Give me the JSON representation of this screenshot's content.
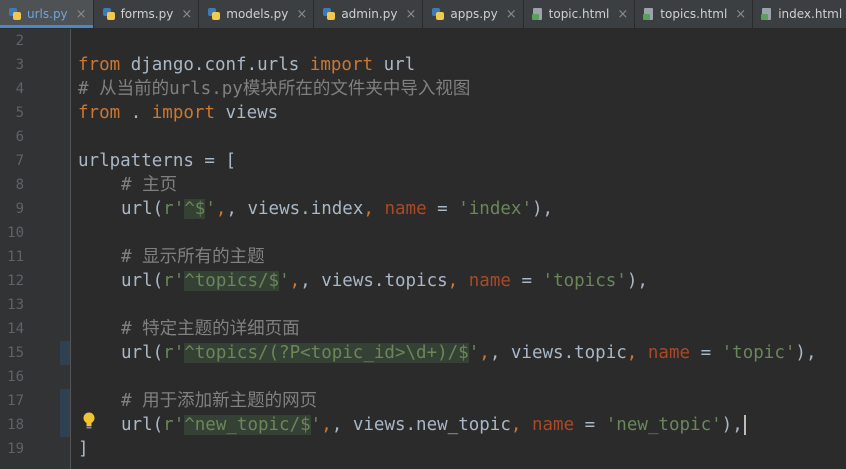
{
  "tabs": [
    {
      "label": "urls.py",
      "type": "py",
      "active": true
    },
    {
      "label": "forms.py",
      "type": "py",
      "active": false
    },
    {
      "label": "models.py",
      "type": "py",
      "active": false
    },
    {
      "label": "admin.py",
      "type": "py",
      "active": false
    },
    {
      "label": "apps.py",
      "type": "py",
      "active": false
    },
    {
      "label": "topic.html",
      "type": "html",
      "active": false
    },
    {
      "label": "topics.html",
      "type": "html",
      "active": false
    },
    {
      "label": "index.html",
      "type": "html",
      "active": false
    }
  ],
  "close_glyph": "×",
  "line_numbers": [
    "2",
    "3",
    "4",
    "5",
    "6",
    "7",
    "8",
    "9",
    "10",
    "11",
    "12",
    "13",
    "14",
    "15",
    "16",
    "17",
    "18",
    "19"
  ],
  "code": {
    "l3": {
      "kw1": "from",
      "mod": " django.conf.urls ",
      "kw2": "import",
      "name": " url"
    },
    "l4": {
      "comment": "# 从当前的urls.py模块所在的文件夹中导入视图"
    },
    "l5": {
      "kw1": "from",
      "mod": " . ",
      "kw2": "import",
      "name": " views"
    },
    "l7": {
      "text": "urlpatterns = ["
    },
    "l8": {
      "comment": "# 主页"
    },
    "l9": {
      "a": "url(",
      "s1": "r'",
      "rx": "^$",
      "s2": "'",
      "b": ", views.index",
      "c": ", ",
      "kw": "name",
      "d": " = ",
      "s3": "'index'",
      "e": "),"
    },
    "l11": {
      "comment": "# 显示所有的主题"
    },
    "l12": {
      "a": "url(",
      "s1": "r'",
      "rx": "^topics/$",
      "s2": "'",
      "b": ", views.topics",
      "c": ", ",
      "kw": "name",
      "d": " = ",
      "s3": "'topics'",
      "e": "),"
    },
    "l14": {
      "comment": "# 特定主题的详细页面"
    },
    "l15": {
      "a": "url(",
      "s1": "r'",
      "rx": "^topics/(?P<topic_id>\\d+)/$",
      "s2": "'",
      "b": ", views.topic",
      "c": ", ",
      "kw": "name",
      "d": " = ",
      "s3": "'topic'",
      "e": "),"
    },
    "l17": {
      "comment": "# 用于添加新主题的网页"
    },
    "l18": {
      "a": "url(",
      "s1": "r'",
      "rx": "^new_topic/$",
      "s2": "'",
      "b": ", views.new_topic",
      "c": ", ",
      "kw": "name",
      "d": " = ",
      "s3": "'new_topic'",
      "e": "),"
    },
    "l19": {
      "text": "]"
    }
  },
  "colors": {
    "keyword": "#cc7832",
    "comment": "#808080",
    "string": "#6a8759",
    "param": "#aa4926",
    "text": "#a9b7c6",
    "accent": "#4a88c7"
  }
}
